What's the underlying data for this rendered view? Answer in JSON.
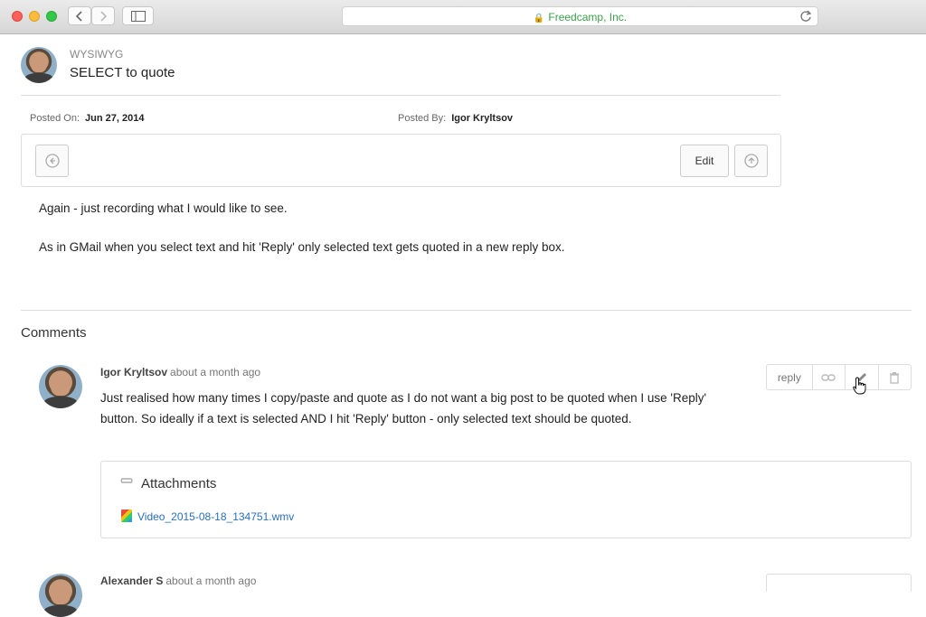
{
  "browser": {
    "url_text": "Freedcamp, Inc."
  },
  "post": {
    "category": "WYSIWYG",
    "title": "SELECT to quote",
    "posted_on_label": "Posted On:",
    "posted_on": "Jun 27, 2014",
    "posted_by_label": "Posted By:",
    "posted_by": "Igor Kryltsov",
    "edit_label": "Edit",
    "body": [
      "Again - just recording what I would like to see.",
      "As in GMail when you select text and hit 'Reply' only selected text gets quoted in a new reply box."
    ]
  },
  "comments": {
    "heading": "Comments",
    "items": [
      {
        "author": "Igor Kryltsov",
        "time": "about a month ago",
        "text": "Just realised how many times I copy/paste and quote as I do not want a big post to be quoted when I use 'Reply' button. So ideally if a text is selected AND I hit 'Reply' button - only selected text should be quoted.",
        "reply_label": "reply",
        "attachments_heading": "Attachments",
        "attachment_file": "Video_2015-08-18_134751.wmv"
      },
      {
        "author": "Alexander S",
        "time": "about a month ago"
      }
    ]
  }
}
